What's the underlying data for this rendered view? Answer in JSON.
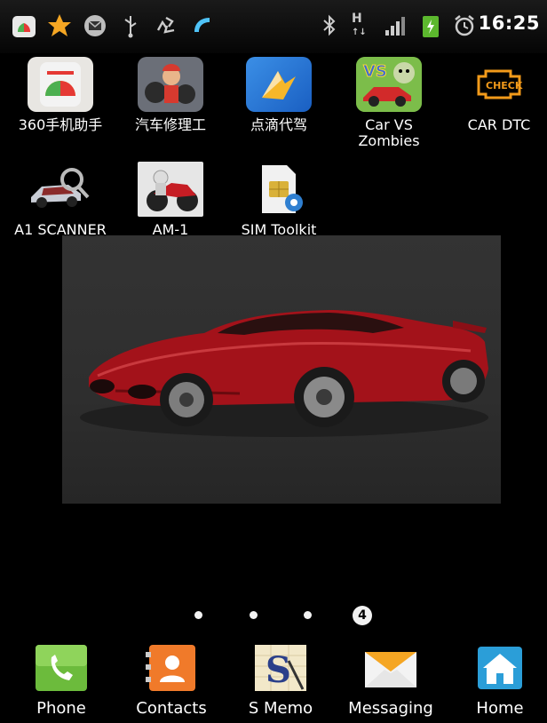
{
  "status_bar": {
    "time": "16:25",
    "signal_label": "H",
    "icons": [
      "app-market-icon",
      "star-icon",
      "mail-icon",
      "usb-icon",
      "recycle-icon",
      "phone-handset-icon",
      "bluetooth-icon",
      "hspa-icon",
      "signal-bars-icon",
      "battery-icon",
      "alarm-icon"
    ]
  },
  "apps": [
    {
      "label": "360手机助手",
      "icon": "360-assistant-icon"
    },
    {
      "label": "汽车修理工",
      "icon": "car-mechanic-icon"
    },
    {
      "label": "点滴代驾",
      "icon": "driver-app-icon"
    },
    {
      "label": "Car VS Zombies",
      "icon": "car-vs-zombies-icon"
    },
    {
      "label": "CAR DTC",
      "icon": "car-dtc-icon"
    },
    {
      "label": "A1 SCANNER",
      "icon": "a1-scanner-icon"
    },
    {
      "label": "AM-1",
      "icon": "am1-icon"
    },
    {
      "label": "SIM Toolkit",
      "icon": "sim-toolkit-icon"
    }
  ],
  "page_indicator": {
    "current": "4",
    "total": 4
  },
  "dock": [
    {
      "label": "Phone",
      "icon": "phone-icon"
    },
    {
      "label": "Contacts",
      "icon": "contacts-icon"
    },
    {
      "label": "S Memo",
      "icon": "s-memo-icon"
    },
    {
      "label": "Messaging",
      "icon": "messaging-icon"
    },
    {
      "label": "Home",
      "icon": "home-icon"
    }
  ],
  "colors": {
    "accent_green": "#7bc043",
    "car_red": "#b3141c",
    "home_blue": "#2b9ed8"
  }
}
